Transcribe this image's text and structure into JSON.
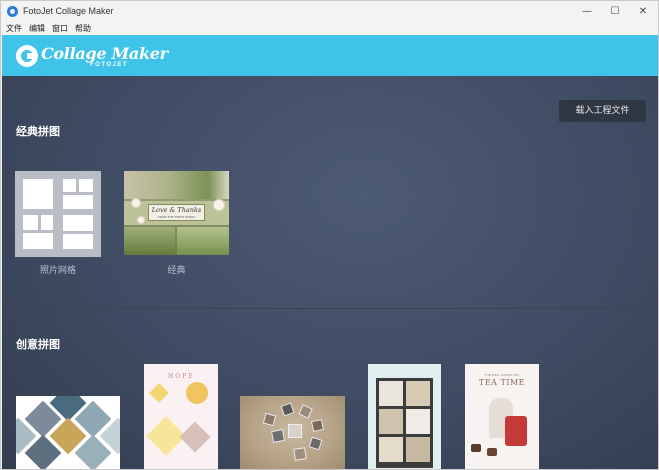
{
  "window": {
    "title": "FotoJet Collage Maker",
    "controls": {
      "minimize": "—",
      "maximize": "☐",
      "close": "✕"
    }
  },
  "menu": {
    "items": [
      {
        "label": "文件"
      },
      {
        "label": "编辑"
      },
      {
        "label": "窗口"
      },
      {
        "label": "帮助"
      }
    ]
  },
  "header": {
    "logo_name": "Collage Maker",
    "logo_sub": "FOTOJET",
    "bg_color": "#3fc3e8"
  },
  "main": {
    "load_project_label": "载入工程文件",
    "classic": {
      "title": "经典拼图",
      "items": [
        {
          "label": "照片网格"
        },
        {
          "label": "经典",
          "card_title": "Love & Thanks",
          "card_sub": "FROM THE SMITH FAMILY"
        }
      ]
    },
    "creative": {
      "title": "创意拼图",
      "items": [
        {
          "name": "diamond"
        },
        {
          "name": "hope",
          "text": "HOPE"
        },
        {
          "name": "circle"
        },
        {
          "name": "hanging"
        },
        {
          "name": "tea",
          "small": "THE WELL WISHES TEA",
          "title": "TEA TIME"
        }
      ]
    }
  }
}
